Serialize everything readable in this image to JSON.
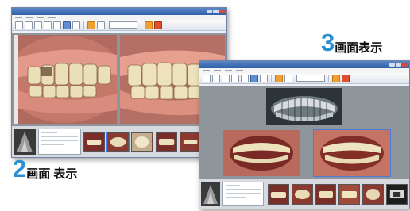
{
  "labels": {
    "two_screen": {
      "number": "2",
      "text": "画面 表示"
    },
    "three_screen": {
      "number": "3",
      "text": "画面表示"
    }
  },
  "windows": {
    "two_screen": {
      "view_count": 2,
      "thumbnails": 6
    },
    "three_screen": {
      "view_count": 3,
      "thumbnails": 6
    }
  },
  "colors": {
    "label_number": "#2c8fd4",
    "titlebar": "#2e5fa8",
    "viewer_bg": "#8e969c"
  },
  "icons": [
    "close-icon",
    "minimize-icon",
    "maximize-icon",
    "camera-icon",
    "print-icon",
    "save-icon",
    "zoom-icon"
  ]
}
